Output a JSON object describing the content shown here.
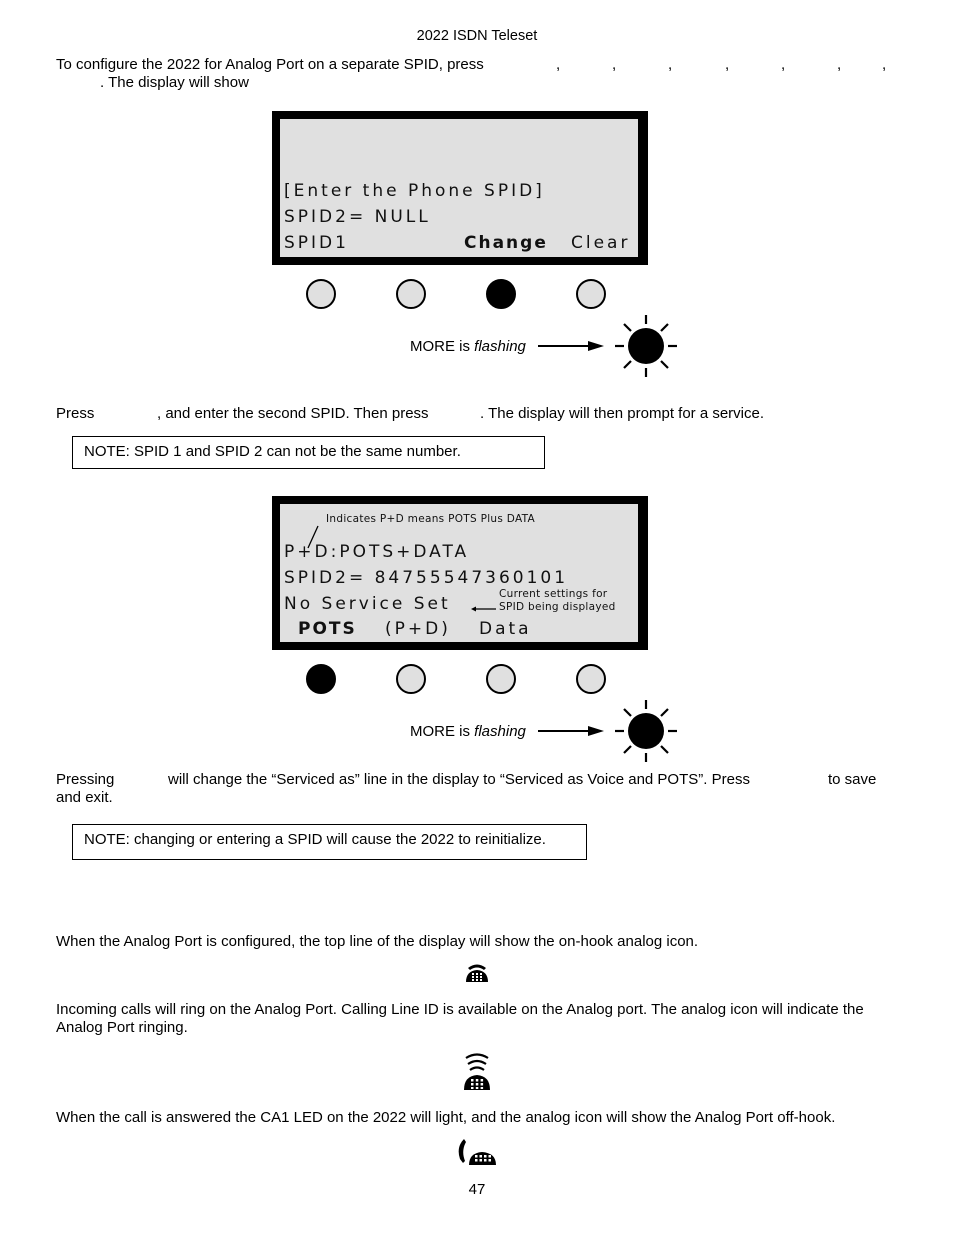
{
  "header": {
    "title": "2022 ISDN Teleset"
  },
  "intro": {
    "line1": "To configure the  2022 for Analog Port on a separate SPID, press",
    "commas": [
      ",",
      ",",
      ",",
      ",",
      ",",
      ",",
      ","
    ],
    "line2": ". The display will show"
  },
  "display1": {
    "lines": [
      "[Enter the Phone SPID]",
      "SPID2= NULL"
    ],
    "softkeys": {
      "left": "SPID1",
      "middle": "Change",
      "right": "Clear"
    },
    "buttons": [
      {
        "name": "softkey-1",
        "active": false
      },
      {
        "name": "softkey-2",
        "active": false
      },
      {
        "name": "softkey-3",
        "active": true
      },
      {
        "name": "softkey-4",
        "active": false
      }
    ],
    "more_label": "MORE is",
    "more_state": "flashing"
  },
  "step2": {
    "press": "Press",
    "mid": ", and enter the second SPID. Then press",
    "end": ". The display will then prompt for a service."
  },
  "note1": "NOTE:  SPID 1 and SPID 2 can not be the same number.",
  "display2": {
    "annotation_top": "Indicates P+D means POTS Plus DATA",
    "lines": [
      "P+D:POTS+DATA",
      "SPID2= 84755547360101",
      "No Service Set"
    ],
    "annotation_side": [
      "Current settings for",
      "SPID being displayed"
    ],
    "softkeys": {
      "left": "POTS",
      "middle": "(P+D)",
      "right": "Data"
    },
    "buttons": [
      {
        "name": "softkey-1",
        "active": true
      },
      {
        "name": "softkey-2",
        "active": false
      },
      {
        "name": "softkey-3",
        "active": false
      },
      {
        "name": "softkey-4",
        "active": false
      }
    ],
    "more_label": "MORE is",
    "more_state": "flashing"
  },
  "step3": {
    "pressing": "Pressing",
    "mid": "will change the “Serviced as” line in the display to “Serviced as Voice and POTS”. Press",
    "end": "to save",
    "line2": "and exit."
  },
  "note2": "NOTE:  changing or entering a SPID will cause the  2022 to reinitialize.",
  "analog": {
    "configured_text": "When the Analog Port is configured, the top line of the display will show the on-hook analog icon.",
    "icon_onhook": "phone-on-hook-icon",
    "incoming_line1": "Incoming calls will ring on the Analog Port. Calling Line ID is available on the Analog port. The analog icon will indicate the",
    "incoming_line2": "Analog Port ringing.",
    "icon_ringing": "phone-ringing-icon",
    "answered_text": "When the call is answered the CA1 LED on the  2022 will light, and the analog icon will show the Analog Port off-hook.",
    "icon_offhook": "phone-off-hook-icon"
  },
  "footer": {
    "page_number": "47"
  }
}
